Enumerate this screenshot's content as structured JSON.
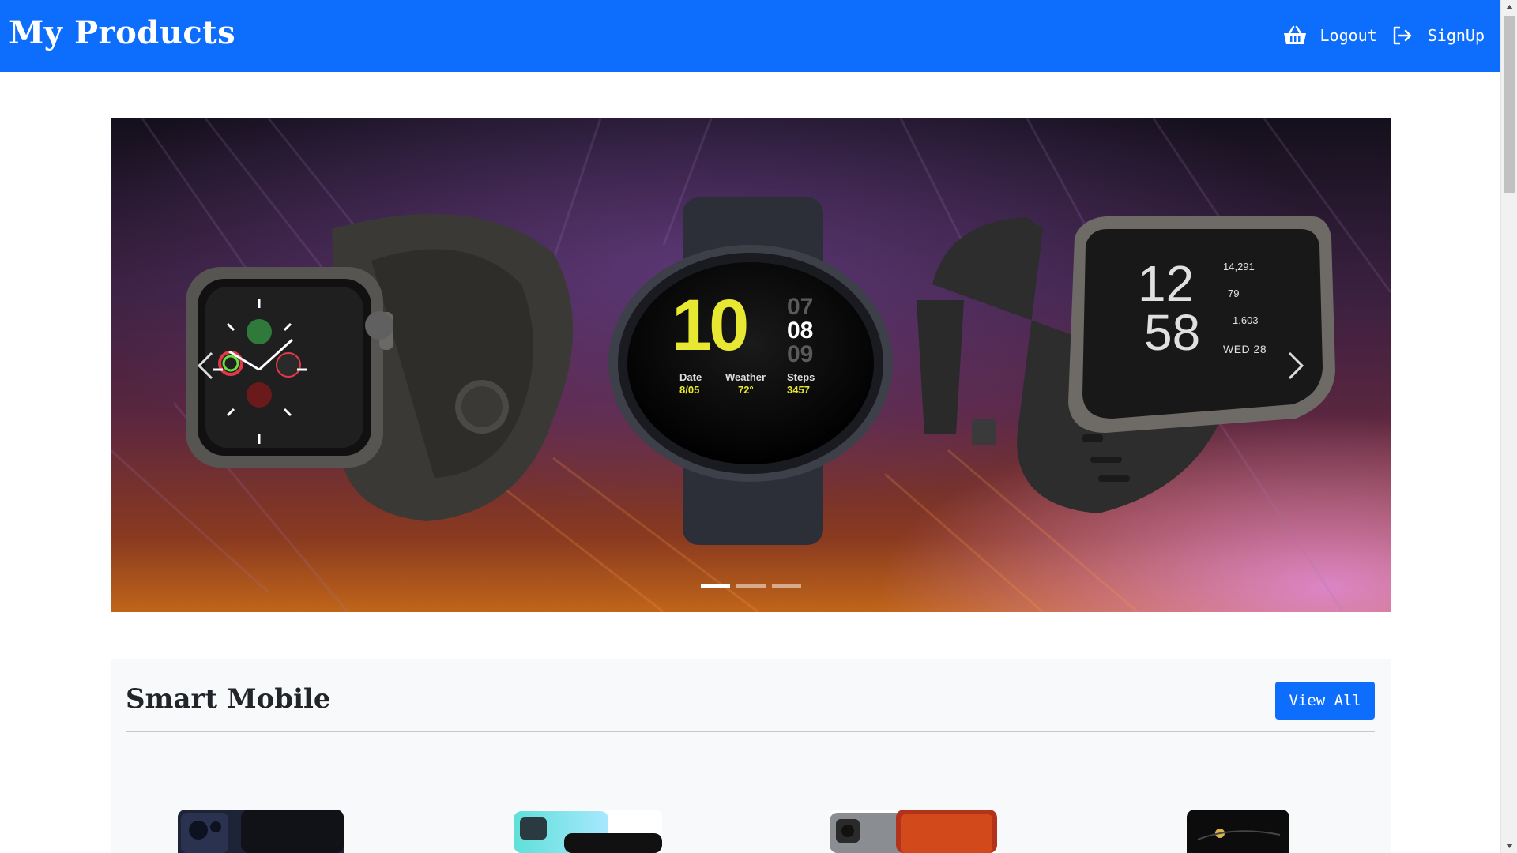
{
  "navbar": {
    "brand": "My Products",
    "links": {
      "logout": "Logout",
      "signup": "SignUp"
    },
    "icons": [
      "shopping-basket-icon",
      "logout-icon"
    ]
  },
  "carousel": {
    "active_slide": 1,
    "slide_count": 3,
    "slide": {
      "watch_center": {
        "hour": "10",
        "min_prev": "07",
        "min": "08",
        "min_next": "09",
        "date_label": "Date",
        "date_value": "8/05",
        "weather_label": "Weather",
        "weather_value": "72°",
        "steps_label": "Steps",
        "steps_value": "3457"
      },
      "watch_right": {
        "hour": "12",
        "min": "58",
        "steps": "14,291",
        "heart": "79",
        "calories": "1,603",
        "day": "WED 28"
      }
    }
  },
  "section": {
    "title": "Smart Mobile",
    "view_all": "View All"
  },
  "colors": {
    "primary": "#0d6efd",
    "section_bg": "#f8f9fa"
  }
}
